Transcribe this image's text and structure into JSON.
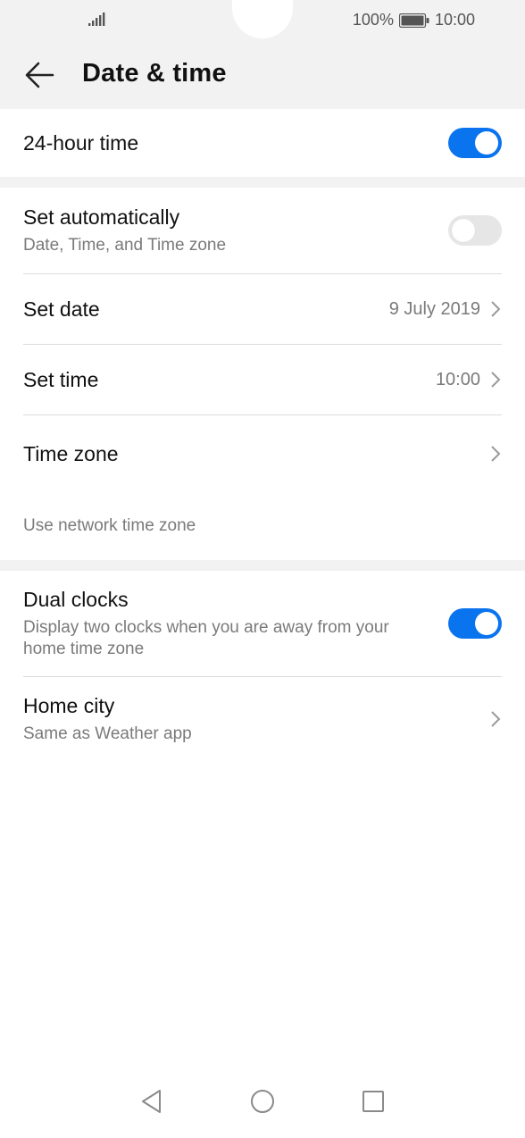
{
  "status": {
    "battery": "100%",
    "time": "10:00"
  },
  "header": {
    "title": "Date & time"
  },
  "settings": {
    "hour24": {
      "label": "24-hour time",
      "enabled": true
    },
    "auto": {
      "label": "Set automatically",
      "sub": "Date, Time, and Time zone",
      "enabled": false
    },
    "date": {
      "label": "Set date",
      "value": "9 July 2019"
    },
    "time": {
      "label": "Set time",
      "value": "10:00"
    },
    "zone": {
      "label": "Time zone"
    },
    "network_note": "Use network time zone",
    "dual": {
      "label": "Dual clocks",
      "sub": "Display two clocks when you are away from your home time zone",
      "enabled": true
    },
    "home": {
      "label": "Home city",
      "sub": "Same as Weather app"
    }
  },
  "colors": {
    "accent": "#0a74ee",
    "toggle_off": "#e6e6e6",
    "background": "#ffffff",
    "section_bg": "#f2f2f2"
  },
  "icons": {
    "back": "arrow-left-icon",
    "signal": "signal-bars-icon",
    "battery": "battery-icon",
    "chevron": "chevron-right-icon",
    "nav_back": "triangle-back-icon",
    "nav_home": "circle-home-icon",
    "nav_recent": "square-recent-icon"
  }
}
